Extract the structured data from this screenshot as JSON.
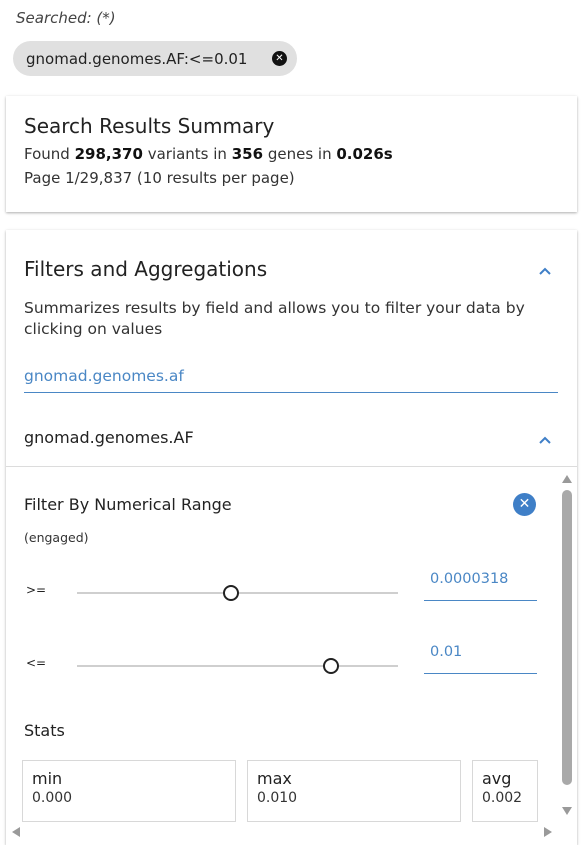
{
  "search": {
    "searched_label": "Searched: (*)",
    "chip_text": "gnomad.genomes.AF:<=0.01"
  },
  "summary": {
    "title": "Search Results Summary",
    "found_prefix": "Found",
    "variant_count": "298,370",
    "variants_word": "variants in",
    "gene_count": "356",
    "genes_word": "genes in",
    "time": "0.026s",
    "page_info": "Page 1/29,837 (10 results per page)"
  },
  "filters": {
    "title": "Filters and Aggregations",
    "description": "Summarizes results by field and allows you to filter your data by clicking on values",
    "search_value": "gnomad.genomes.af",
    "aggregation_name": "gnomad.genomes.AF",
    "range_title": "Filter By Numerical Range",
    "engaged_label": "(engaged)",
    "gte_label": ">=",
    "gte_value": "0.0000318",
    "gte_slider_fraction": 0.48,
    "lte_label": "<=",
    "lte_value": "0.01",
    "lte_slider_fraction": 0.79,
    "stats_label": "Stats",
    "stats": [
      {
        "name": "min",
        "value": "0.000"
      },
      {
        "name": "max",
        "value": "0.010"
      },
      {
        "name": "avg",
        "value": "0.002"
      }
    ]
  },
  "colors": {
    "accent": "#4a87c5",
    "chip_bg": "#e0e0e0",
    "clear_button": "#3f7fc7"
  }
}
